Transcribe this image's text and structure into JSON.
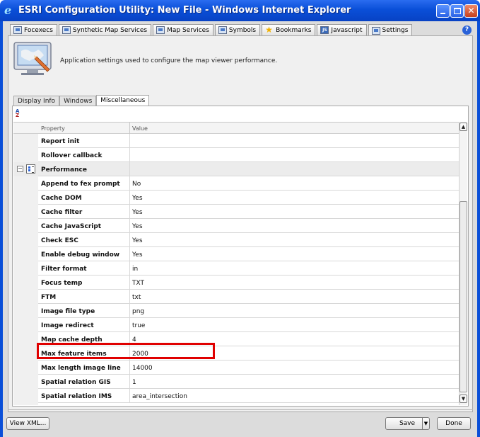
{
  "window": {
    "title": "ESRI Configuration Utility: New File - Windows Internet Explorer",
    "min_label": "_",
    "max_label": "□",
    "close_label": "✕"
  },
  "tabs": [
    {
      "label": "Focexecs",
      "icon": "focexecs-icon"
    },
    {
      "label": "Synthetic Map Services",
      "icon": "synthetic-map-icon"
    },
    {
      "label": "Map Services",
      "icon": "map-services-icon"
    },
    {
      "label": "Symbols",
      "icon": "symbols-icon"
    },
    {
      "label": "Bookmarks",
      "icon": "bookmarks-icon"
    },
    {
      "label": "Javascript",
      "icon": "javascript-icon",
      "badge": "JS"
    },
    {
      "label": "Settings",
      "icon": "settings-icon",
      "active": true
    }
  ],
  "help_label": "?",
  "settings": {
    "description": "Application settings used to configure the map viewer performance."
  },
  "subtabs": [
    {
      "label": "Display Info"
    },
    {
      "label": "Windows"
    },
    {
      "label": "Miscellaneous",
      "active": true
    }
  ],
  "grid": {
    "sort_icon_label_a": "A",
    "sort_icon_label_z": "Z",
    "header_property": "Property",
    "header_value": "Value",
    "rows": [
      {
        "name": "Report init",
        "value": ""
      },
      {
        "name": "Rollover callback",
        "value": ""
      },
      {
        "name": "Performance",
        "value": "",
        "category": true
      },
      {
        "name": "Append to fex prompt",
        "value": "No"
      },
      {
        "name": "Cache DOM",
        "value": "Yes"
      },
      {
        "name": "Cache filter",
        "value": "Yes"
      },
      {
        "name": "Cache JavaScript",
        "value": "Yes"
      },
      {
        "name": "Check ESC",
        "value": "Yes"
      },
      {
        "name": "Enable debug window",
        "value": "Yes"
      },
      {
        "name": "Filter format",
        "value": "in"
      },
      {
        "name": "Focus temp",
        "value": "TXT"
      },
      {
        "name": "FTM",
        "value": "txt"
      },
      {
        "name": "Image file type",
        "value": "png"
      },
      {
        "name": "Image redirect",
        "value": "true"
      },
      {
        "name": "Map cache depth",
        "value": "4"
      },
      {
        "name": "Max feature items",
        "value": "2000",
        "highlighted": true
      },
      {
        "name": "Max length image line",
        "value": "14000"
      },
      {
        "name": "Spatial relation GIS",
        "value": "1"
      },
      {
        "name": "Spatial relation IMS",
        "value": "area_intersection"
      }
    ]
  },
  "buttons": {
    "view_xml": "View XML...",
    "save": "Save",
    "save_dropdown": "▼",
    "done": "Done"
  },
  "colors": {
    "titlebar": "#0a4fd8",
    "highlight": "#e00000"
  }
}
